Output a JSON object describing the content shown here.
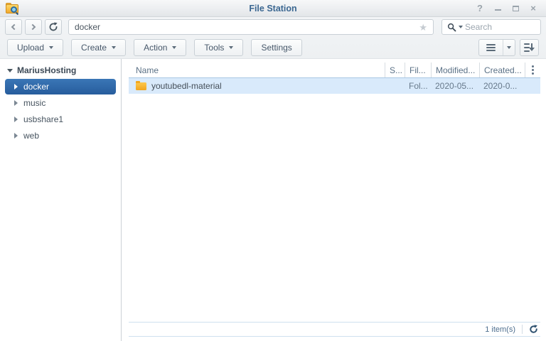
{
  "window": {
    "title": "File Station"
  },
  "address_bar": {
    "path_value": "docker",
    "search_placeholder": "Search"
  },
  "toolbar": {
    "buttons": [
      "Upload",
      "Create",
      "Action",
      "Tools",
      "Settings"
    ]
  },
  "sidebar": {
    "root_label": "MariusHosting",
    "items": [
      {
        "label": "docker",
        "selected": true
      },
      {
        "label": "music",
        "selected": false
      },
      {
        "label": "usbshare1",
        "selected": false
      },
      {
        "label": "web",
        "selected": false
      }
    ]
  },
  "file_list": {
    "columns": [
      "Name",
      "S...",
      "Fil...",
      "Modified...",
      "Created..."
    ],
    "rows": [
      {
        "name": "youtubedl-material",
        "size": "",
        "file_type": "Fol...",
        "modified": "2020-05...",
        "created": "2020-0..."
      }
    ]
  },
  "status_bar": {
    "item_count": "1 item(s)"
  },
  "glyphs": {
    "help": "?",
    "close": "×",
    "star": "★"
  },
  "icons": {
    "app": "folder-with-magnifier",
    "back": "chevron-left",
    "forward": "chevron-right",
    "refresh": "circular-arrow",
    "favorite": "star",
    "search": "magnifier",
    "view_mode": "hamburger-list",
    "sort": "sort-descending-arrow",
    "column_menu": "vertical-dots",
    "row": "yellow-folder"
  },
  "colors": {
    "selection_blue": "#2b65a7",
    "row_selection": "#d9eafb",
    "title_text": "#3b6791",
    "header_underline": "#a9c7e4",
    "folder_yellow": "#f2a81f"
  }
}
